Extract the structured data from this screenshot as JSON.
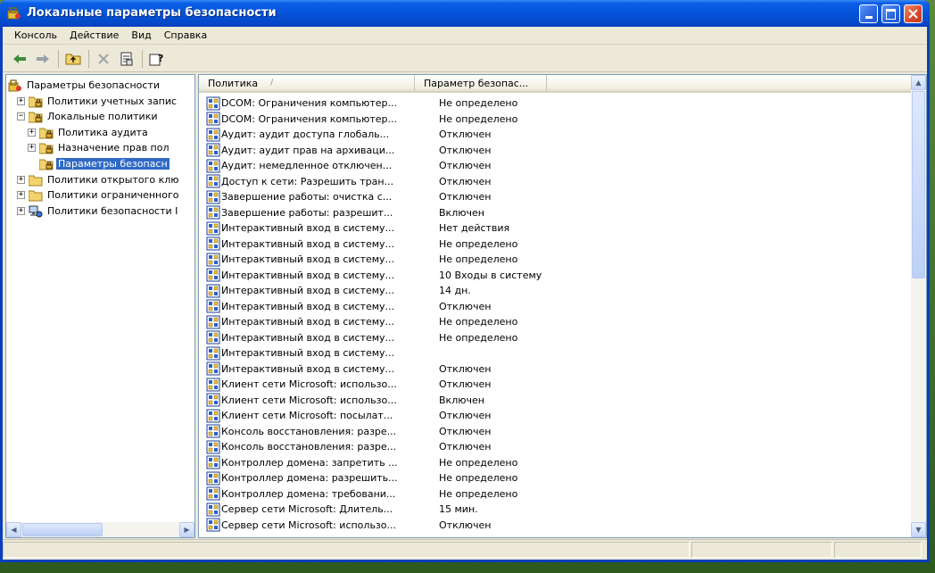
{
  "window": {
    "title": "Локальные параметры безопасности"
  },
  "menu": [
    "Консоль",
    "Действие",
    "Вид",
    "Справка"
  ],
  "toolbar": {
    "icons": [
      "back-arrow-icon",
      "forward-arrow-icon",
      "up-folder-icon",
      "delete-icon",
      "properties-icon",
      "help-icon"
    ]
  },
  "tree": {
    "items": [
      {
        "label": "Параметры безопасности",
        "level": 0,
        "expander": "",
        "icon": "security-icon"
      },
      {
        "label": "Политики учетных запис",
        "level": 1,
        "expander": "+",
        "icon": "folder-lock-icon"
      },
      {
        "label": "Локальные политики",
        "level": 1,
        "expander": "−",
        "icon": "folder-lock-icon"
      },
      {
        "label": "Политика аудита",
        "level": 2,
        "expander": "+",
        "icon": "folder-lock-icon"
      },
      {
        "label": "Назначение прав пол",
        "level": 2,
        "expander": "+",
        "icon": "folder-lock-icon"
      },
      {
        "label": "Параметры безопасн",
        "level": 2,
        "expander": "",
        "icon": "folder-lock-icon",
        "selected": true
      },
      {
        "label": "Политики открытого клю",
        "level": 1,
        "expander": "+",
        "icon": "folder-icon"
      },
      {
        "label": "Политики ограниченного",
        "level": 1,
        "expander": "+",
        "icon": "folder-icon"
      },
      {
        "label": "Политики безопасности I",
        "level": 1,
        "expander": "+",
        "icon": "network-icon"
      }
    ]
  },
  "list": {
    "columns": [
      "Политика",
      "Параметр безопас..."
    ],
    "sort_indicator": "/",
    "rows": [
      {
        "name": "DCOM: Ограничения компьютер...",
        "value": "Не определено"
      },
      {
        "name": "DCOM: Ограничения компьютер...",
        "value": "Не определено"
      },
      {
        "name": "Аудит: аудит доступа глобаль...",
        "value": "Отключен"
      },
      {
        "name": "Аудит: аудит прав на архиваци...",
        "value": "Отключен"
      },
      {
        "name": "Аудит: немедленное отключен...",
        "value": "Отключен"
      },
      {
        "name": "Доступ к сети: Разрешить тран...",
        "value": "Отключен"
      },
      {
        "name": "Завершение работы: очистка с...",
        "value": "Отключен"
      },
      {
        "name": "Завершение работы: разрешит...",
        "value": "Включен"
      },
      {
        "name": "Интерактивный вход в систему...",
        "value": "Нет действия"
      },
      {
        "name": "Интерактивный вход в систему...",
        "value": "Не определено"
      },
      {
        "name": "Интерактивный вход в систему...",
        "value": "Не определено"
      },
      {
        "name": "Интерактивный вход в систему...",
        "value": "10 Входы в систему"
      },
      {
        "name": "Интерактивный вход в систему...",
        "value": "14 дн."
      },
      {
        "name": "Интерактивный вход в систему...",
        "value": "Отключен"
      },
      {
        "name": "Интерактивный вход в систему...",
        "value": "Не определено"
      },
      {
        "name": "Интерактивный вход в систему...",
        "value": "Не определено"
      },
      {
        "name": "Интерактивный вход в систему...",
        "value": ""
      },
      {
        "name": "Интерактивный вход в систему...",
        "value": "Отключен"
      },
      {
        "name": "Клиент сети Microsoft: использо...",
        "value": "Отключен"
      },
      {
        "name": "Клиент сети Microsoft: использо...",
        "value": "Включен"
      },
      {
        "name": "Клиент сети Microsoft: посылат...",
        "value": "Отключен"
      },
      {
        "name": "Консоль восстановления: разре...",
        "value": "Отключен"
      },
      {
        "name": "Консоль восстановления: разре...",
        "value": "Отключен"
      },
      {
        "name": "Контроллер домена: запретить ...",
        "value": "Не определено"
      },
      {
        "name": "Контроллер домена: разрешить...",
        "value": "Не определено"
      },
      {
        "name": "Контроллер домена: требовани...",
        "value": "Не определено"
      },
      {
        "name": "Сервер сети Microsoft: Длитель...",
        "value": "15 мин."
      },
      {
        "name": "Сервер сети Microsoft: использо...",
        "value": "Отключен"
      }
    ]
  },
  "colors": {
    "titlebar": "#0553d8",
    "selection": "#316ac5",
    "window_bg": "#ece9d8"
  }
}
